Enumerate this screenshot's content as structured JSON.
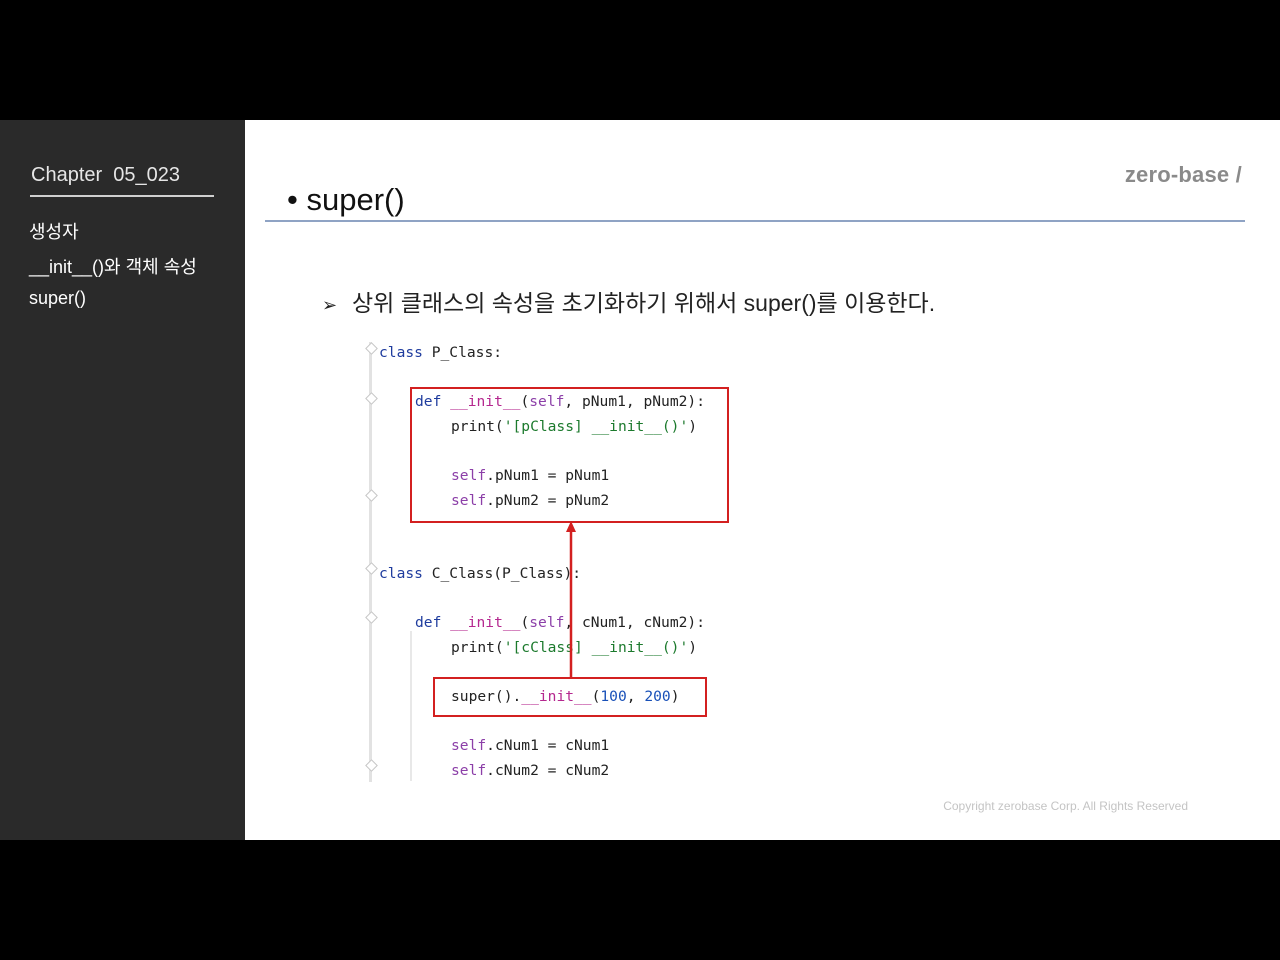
{
  "sidebar": {
    "chapter": "Chapter  05_023",
    "items": [
      "생성자",
      "__init__()와 객체 속성",
      "super()"
    ]
  },
  "slide": {
    "brand": "zero-base /",
    "title": "• super()",
    "description_arrow": "➢",
    "description": "상위 클래스의 속성을 초기화하기 위해서 super()를 이용한다.",
    "copyright": "Copyright zerobase Corp. All Rights Reserved"
  },
  "code": {
    "class1": {
      "kw": "class",
      "name": " P_Class:"
    },
    "p_def": {
      "kw": "def",
      "fn": "__init__",
      "open": "(",
      "self": "self",
      "args": ", pNum1, pNum2):"
    },
    "p_print": {
      "call": "print(",
      "str": "'[pClass] __init__()'",
      "close": ")"
    },
    "p_assign1": {
      "self": "self",
      "rest": ".pNum1 = pNum1"
    },
    "p_assign2": {
      "self": "self",
      "rest": ".pNum2 = pNum2"
    },
    "class2": {
      "kw": "class",
      "name": " C_Class(P_Class):"
    },
    "c_def": {
      "kw": "def",
      "fn": "__init__",
      "open": "(",
      "self": "self",
      "args": ", cNum1, cNum2):"
    },
    "c_print": {
      "call": "print(",
      "str": "'[cClass] __init__()'",
      "close": ")"
    },
    "c_super": {
      "call": "super().",
      "fn": "__init__",
      "open": "(",
      "n1": "100",
      "sep": ", ",
      "n2": "200",
      "close": ")"
    },
    "c_assign1": {
      "self": "self",
      "rest": ".cNum1 = cNum1"
    },
    "c_assign2": {
      "self": "self",
      "rest": ".cNum2 = cNum2"
    }
  },
  "colors": {
    "highlight": "#d32020",
    "sidebar_bg": "#2a2a2a",
    "rule": "#8fa3c4"
  }
}
